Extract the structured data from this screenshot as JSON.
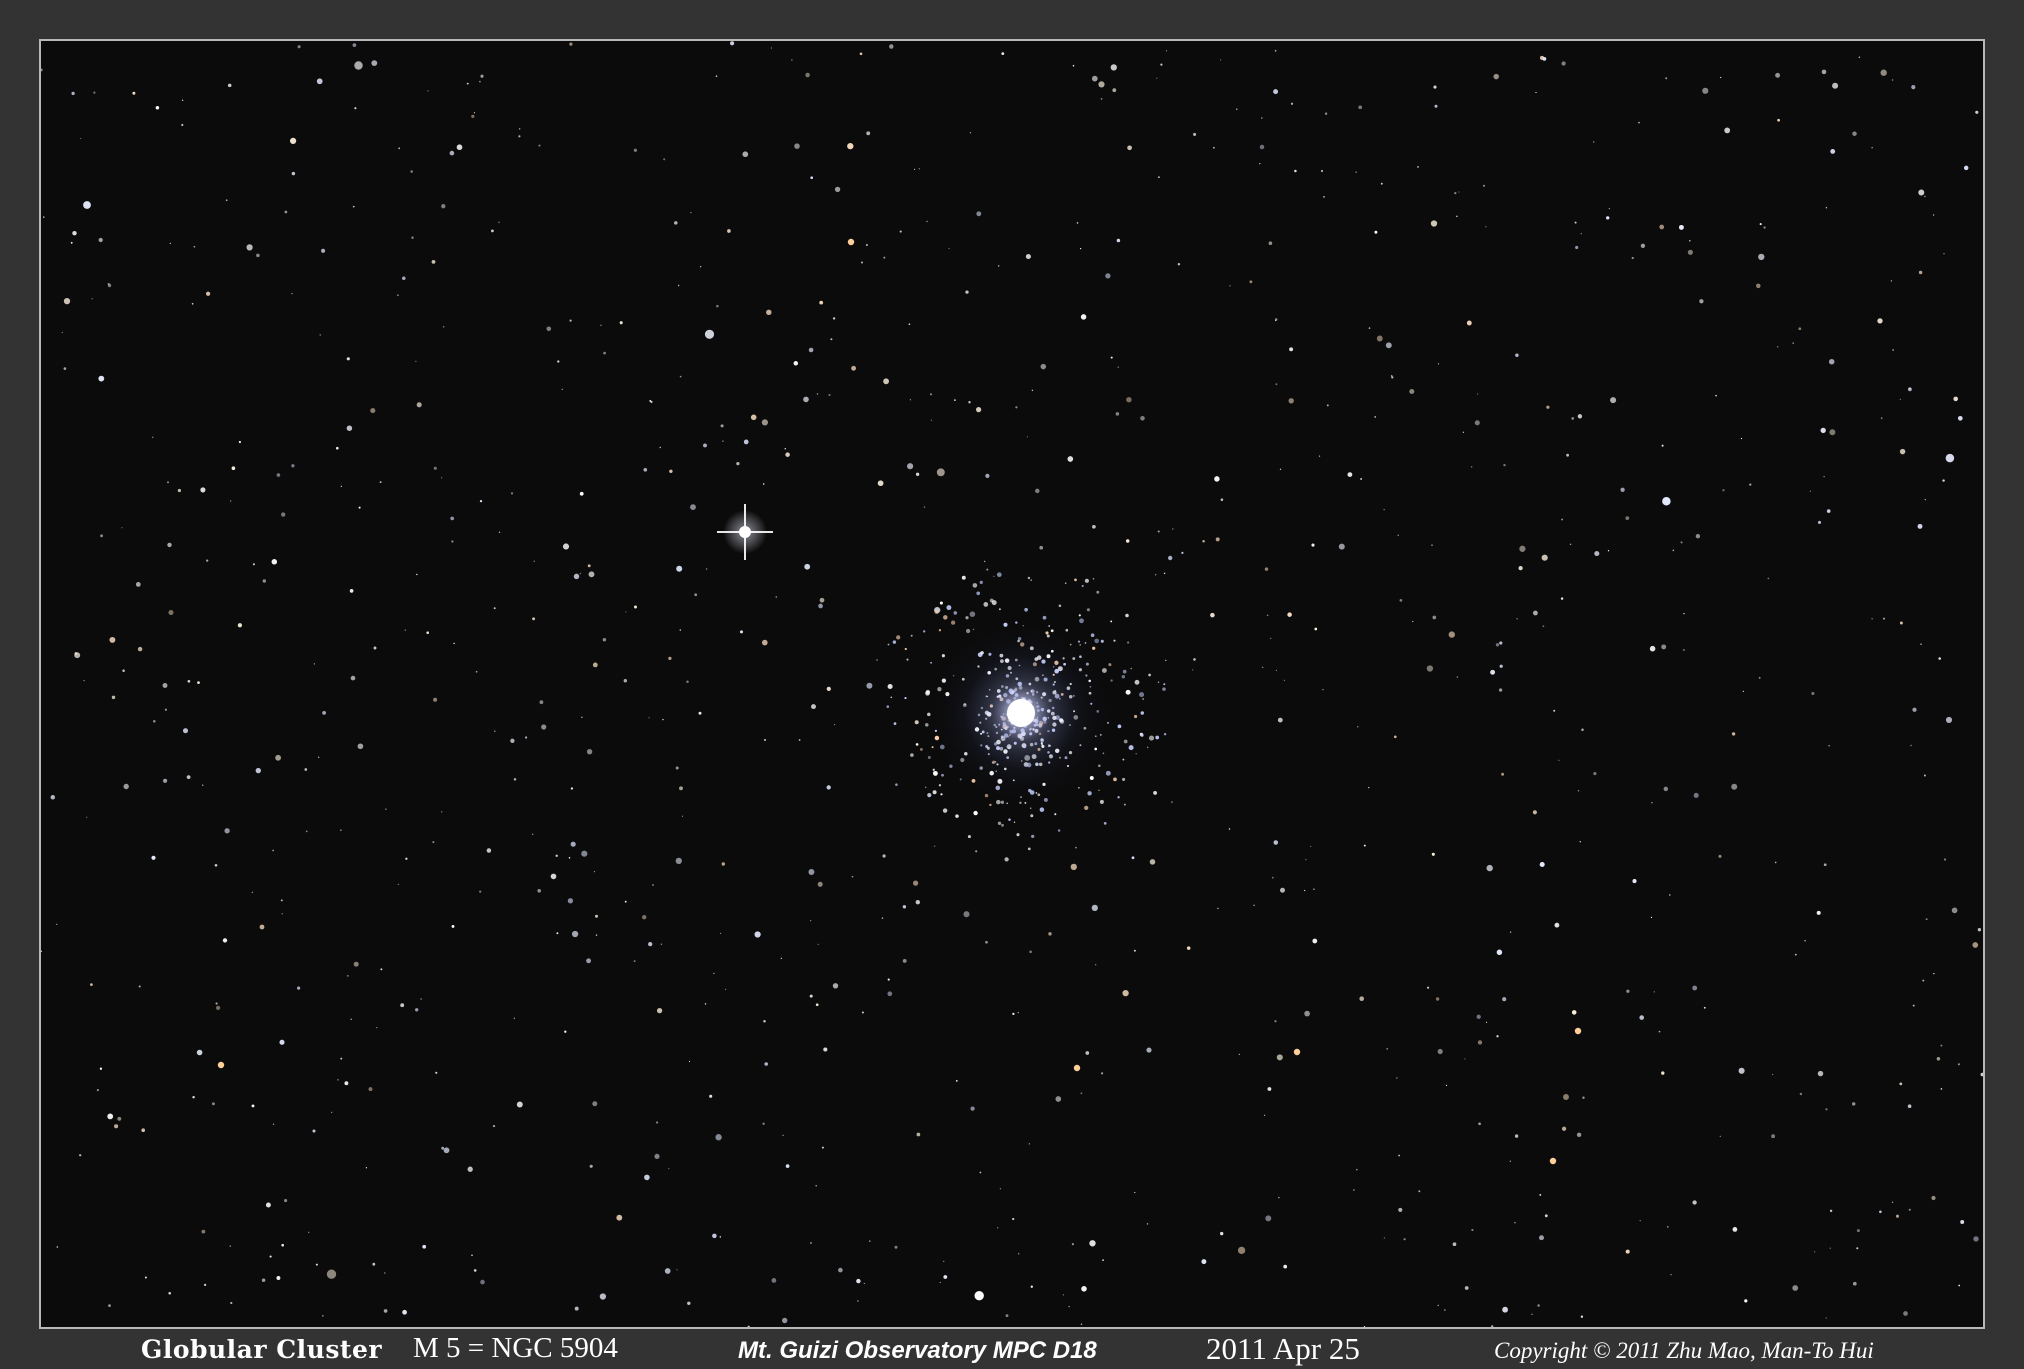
{
  "photo": {
    "subject": "globular cluster in a star field",
    "background_color": "#0b0b0c",
    "frame_color": "#b8b8b8",
    "page_color": "#333333"
  },
  "caption": {
    "object_type": "Globular Cluster",
    "designation": "M 5 = NGC 5904",
    "observatory": "Mt. Guizi Observatory  MPC D18",
    "date": "2011 Apr 25",
    "copyright": "Copyright © 2011 Zhu Mao, Man-To Hui"
  }
}
